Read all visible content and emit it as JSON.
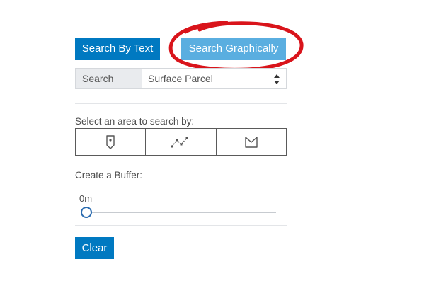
{
  "tabs": {
    "search_by_text": "Search By Text",
    "search_graphically": "Search Graphically"
  },
  "search": {
    "label": "Search",
    "selected_option": "Surface Parcel"
  },
  "area": {
    "label": "Select an area to search by:",
    "tools": [
      "point-tool",
      "polyline-tool",
      "polygon-tool"
    ]
  },
  "buffer": {
    "label": "Create a Buffer:",
    "value_text": "0m",
    "value": 0
  },
  "clear_label": "Clear",
  "colors": {
    "primary": "#0079c1",
    "active_tab": "#5aaee0",
    "highlight": "#d9141b"
  }
}
